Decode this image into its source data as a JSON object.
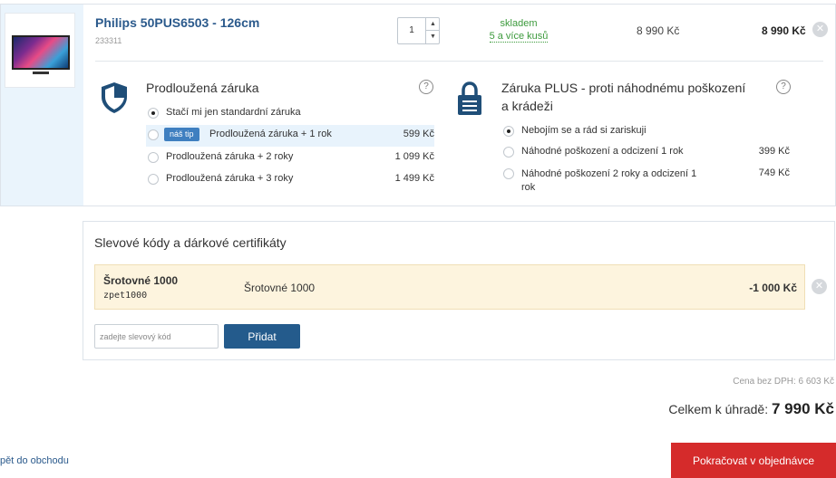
{
  "product": {
    "name": "Philips 50PUS6503 - 126cm",
    "code": "233311",
    "quantity": "1",
    "stock_status": "skladem",
    "stock_qty": "5 a více kusů",
    "unit_price": "8 990 Kč",
    "total_price": "8 990 Kč"
  },
  "warranty": {
    "title": "Prodloužená záruka",
    "help": "?",
    "options": [
      {
        "label": "Stačí mi jen standardní záruka",
        "price": "",
        "checked": true
      },
      {
        "badge": "náš tip",
        "label": "Prodloužená záruka + 1 rok",
        "price": "599 Kč",
        "checked": false
      },
      {
        "label": "Prodloužená záruka + 2 roky",
        "price": "1 099 Kč",
        "checked": false
      },
      {
        "label": "Prodloužená záruka + 3 roky",
        "price": "1 499 Kč",
        "checked": false
      }
    ]
  },
  "insurance": {
    "title_line1": "Záruka PLUS - proti náhodnému poškození",
    "title_line2": "a krádeži",
    "help": "?",
    "options": [
      {
        "label": "Nebojím se a rád si zariskuji",
        "price": "",
        "checked": true
      },
      {
        "label": "Náhodné poškození a odcizení 1 rok",
        "price": "399 Kč",
        "checked": false
      },
      {
        "label_line1": "Náhodné poškození 2 roky a odcizení 1",
        "label_line2": "rok",
        "price": "749 Kč",
        "checked": false
      }
    ]
  },
  "discount": {
    "title": "Slevové kódy a dárkové certifikáty",
    "coupon": {
      "name": "Šrotovné 1000",
      "code": "zpet1000",
      "description": "Šrotovné 1000",
      "amount": "-1 000 Kč"
    },
    "input_placeholder": "zadejte slevový kód",
    "add_label": "Přidat"
  },
  "summary": {
    "price_without_vat": "Cena bez DPH: 6 603 Kč",
    "total_label": "Celkem k úhradě:",
    "total_amount": "7 990 Kč"
  },
  "nav": {
    "back_label": "pět do obchodu",
    "continue_label": "Pokračovat v objednávce"
  },
  "colors": {
    "accent_blue": "#245b8c",
    "stock_green": "#3c9a3c",
    "continue_red": "#d52b2b",
    "coupon_bg": "#fdf4de"
  }
}
